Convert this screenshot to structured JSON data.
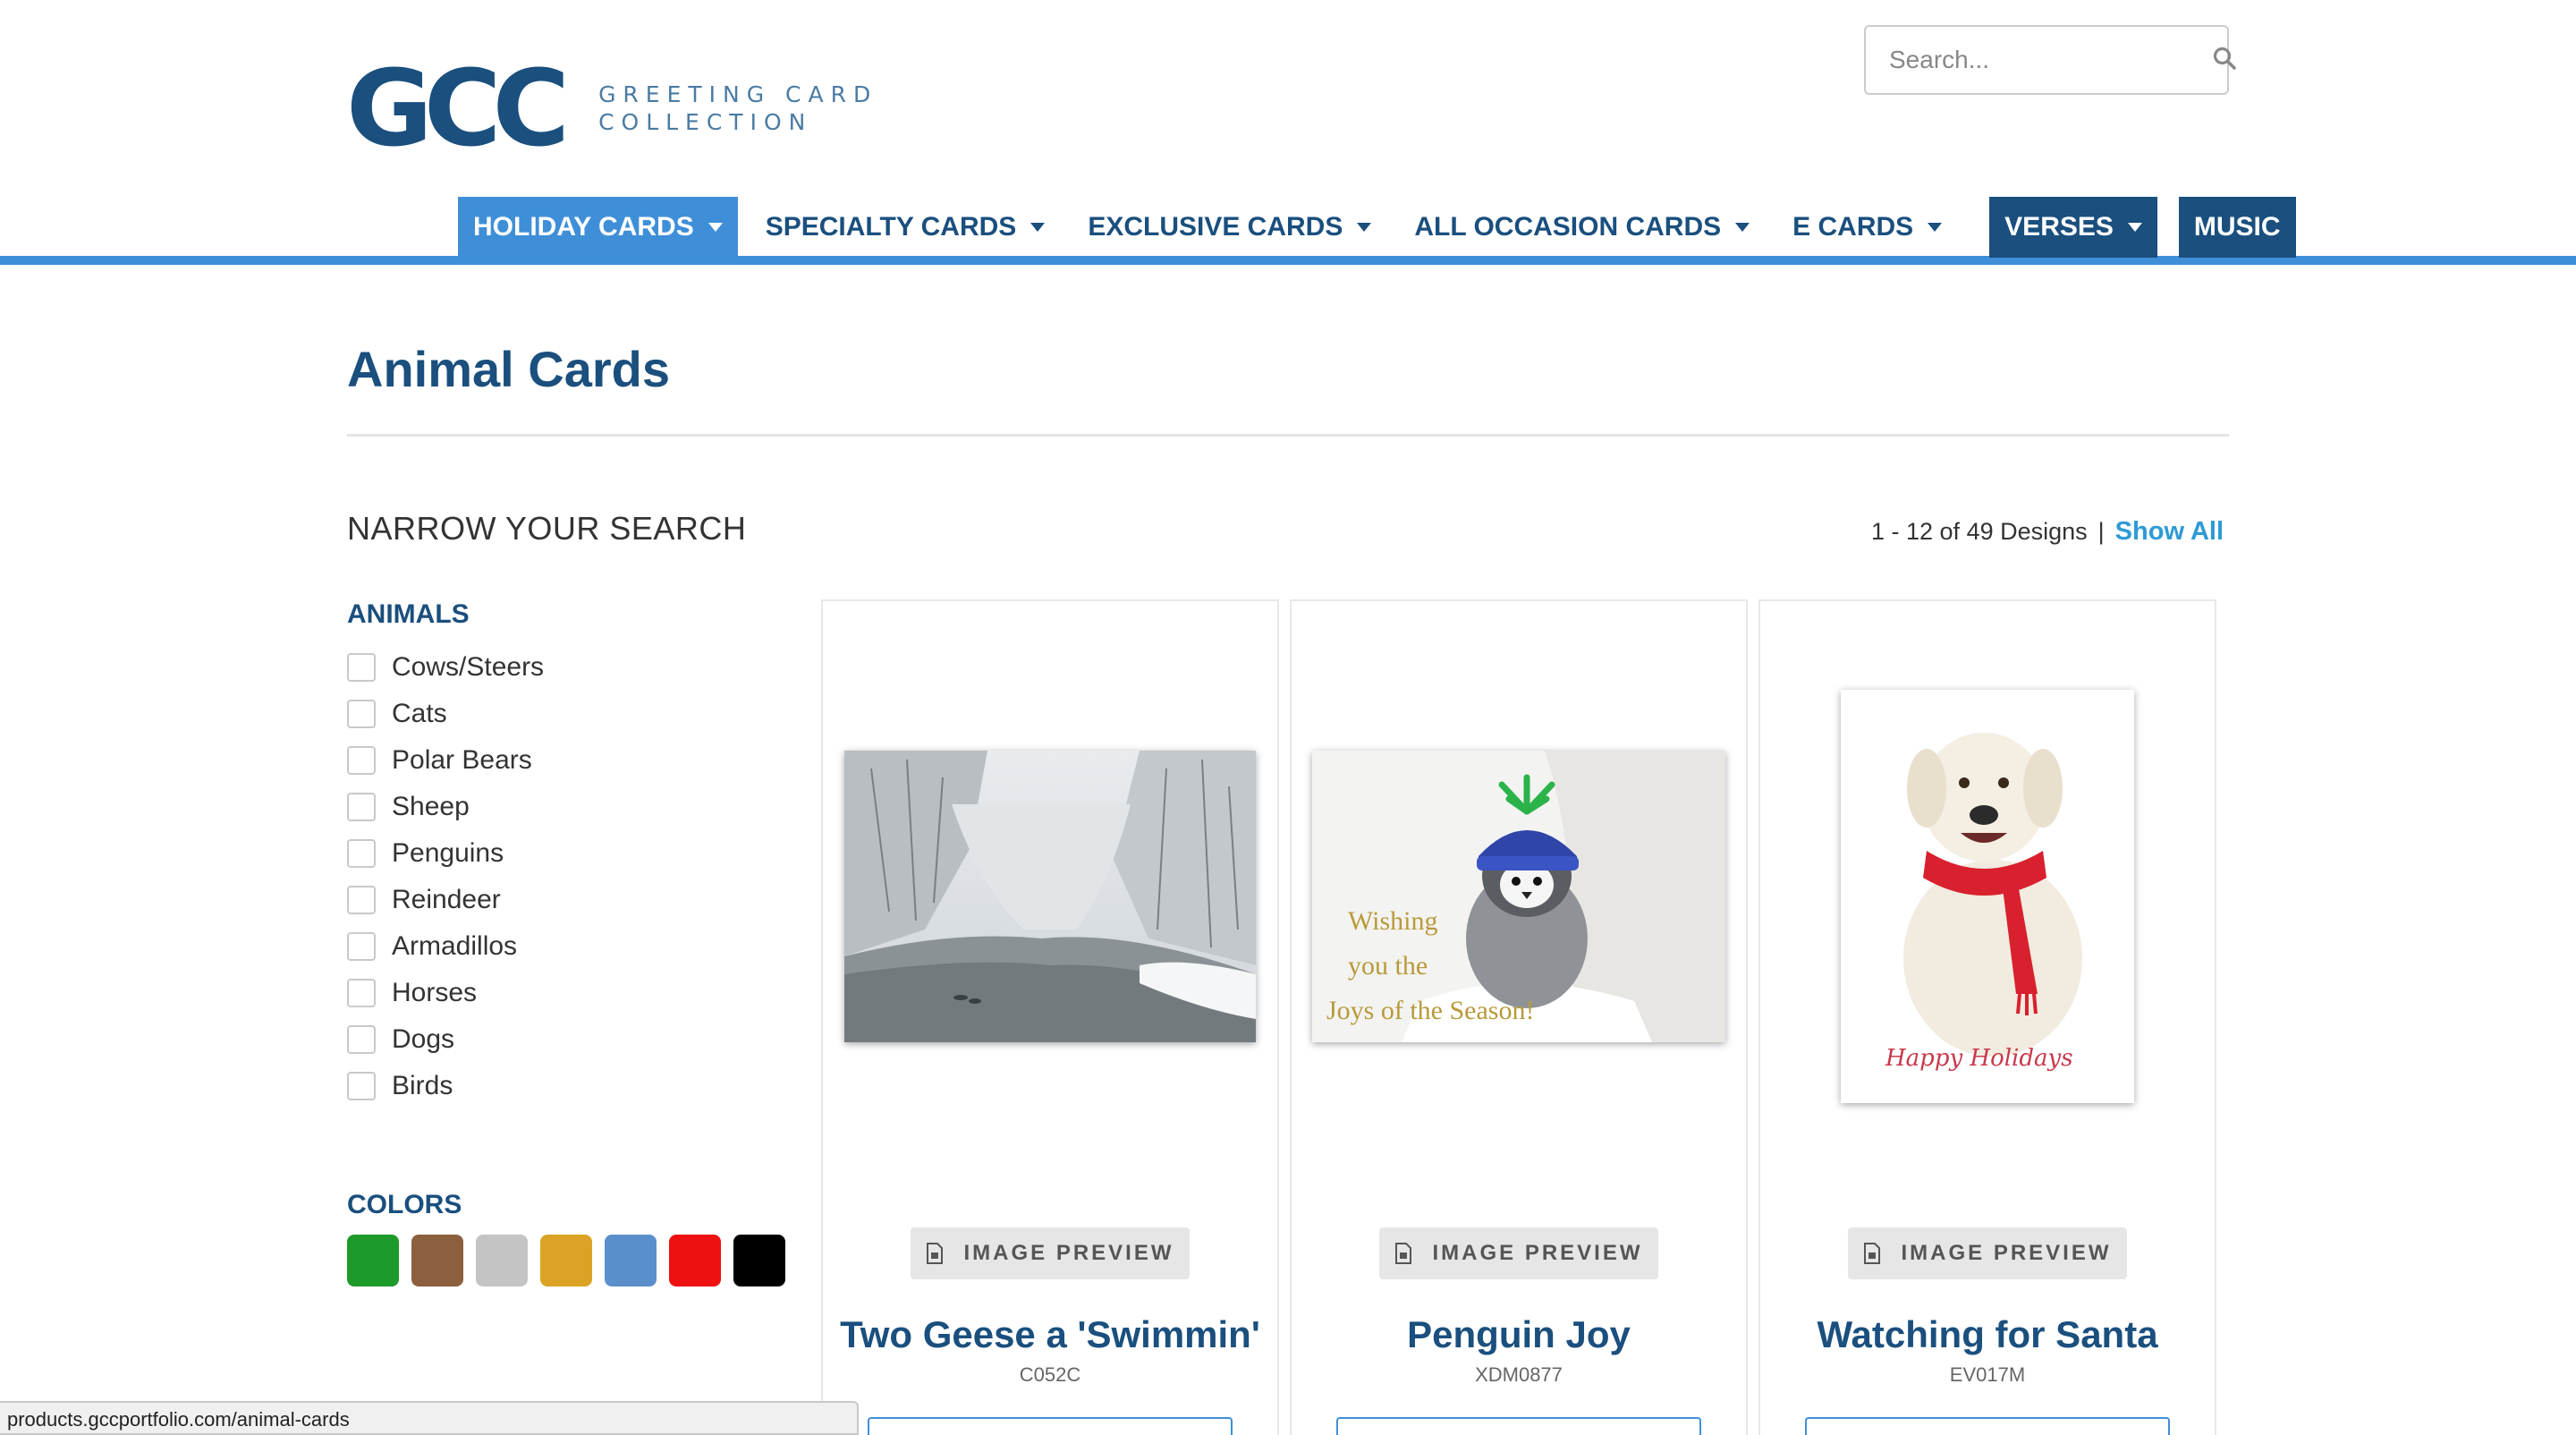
{
  "header": {
    "logo_mark": "GCC",
    "logo_line1": "GREETING CARD",
    "logo_line2": "COLLECTION",
    "search_placeholder": "Search..."
  },
  "nav": {
    "items": [
      {
        "label": "HOLIDAY CARDS",
        "dropdown": true
      },
      {
        "label": "SPECIALTY CARDS",
        "dropdown": true
      },
      {
        "label": "EXCLUSIVE CARDS",
        "dropdown": true
      },
      {
        "label": "ALL OCCASION CARDS",
        "dropdown": true
      },
      {
        "label": "E CARDS",
        "dropdown": true
      },
      {
        "label": "VERSES",
        "dropdown": true
      },
      {
        "label": "MUSIC",
        "dropdown": false
      }
    ]
  },
  "page": {
    "title": "Animal Cards",
    "narrow_title": "NARROW YOUR SEARCH",
    "results_text": "1 - 12 of 49 Designs",
    "results_sep": "|",
    "show_all": "Show All"
  },
  "filters": {
    "animals_heading": "ANIMALS",
    "animals": [
      "Cows/Steers",
      "Cats",
      "Polar Bears",
      "Sheep",
      "Penguins",
      "Reindeer",
      "Armadillos",
      "Horses",
      "Dogs",
      "Birds"
    ],
    "colors_heading": "COLORS",
    "colors": [
      "#1e9a2b",
      "#8c5f3f",
      "#c4c4c4",
      "#dba326",
      "#5b8fcc",
      "#ee1111",
      "#000000"
    ]
  },
  "products": [
    {
      "name": "Two Geese a 'Swimmin'",
      "sku": "C052C",
      "preview_label": "IMAGE PREVIEW"
    },
    {
      "name": "Penguin Joy",
      "sku": "XDM0877",
      "preview_label": "IMAGE PREVIEW",
      "card_text": [
        "Wishing",
        "you the",
        "Joys of the Season!"
      ]
    },
    {
      "name": "Watching for Santa",
      "sku": "EV017M",
      "preview_label": "IMAGE PREVIEW",
      "card_text": [
        "Happy Holidays"
      ]
    }
  ],
  "status_bar": {
    "url": "products.gccportfolio.com/animal-cards"
  }
}
